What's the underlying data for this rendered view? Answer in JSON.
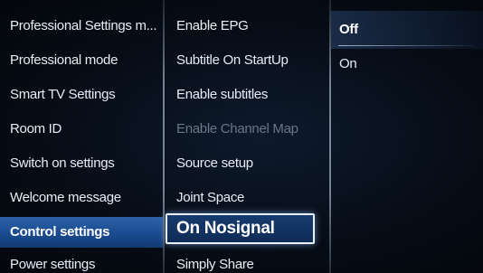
{
  "menu_level1": {
    "items": [
      {
        "label": "Professional Settings m..."
      },
      {
        "label": "Professional mode"
      },
      {
        "label": "Smart TV Settings"
      },
      {
        "label": "Room ID"
      },
      {
        "label": "Switch on settings"
      },
      {
        "label": "Welcome message"
      },
      {
        "label": "Control settings",
        "state": "selected"
      },
      {
        "label": "Power settings"
      }
    ]
  },
  "menu_level2": {
    "items": [
      {
        "label": "Enable EPG"
      },
      {
        "label": "Subtitle On StartUp"
      },
      {
        "label": "Enable subtitles"
      },
      {
        "label": "Enable Channel Map",
        "state": "disabled"
      },
      {
        "label": "Source setup"
      },
      {
        "label": "Joint Space"
      },
      {
        "label": "On Nosignal",
        "state": "focused"
      },
      {
        "label": "Simply Share"
      }
    ]
  },
  "menu_level3": {
    "items": [
      {
        "label": "Off",
        "state": "current"
      },
      {
        "label": "On"
      }
    ]
  },
  "colors": {
    "selection_blue": "#1a4a8f",
    "focus_border": "#e9f1ff",
    "disabled_text": "#6b7686",
    "background": "#070d17"
  }
}
